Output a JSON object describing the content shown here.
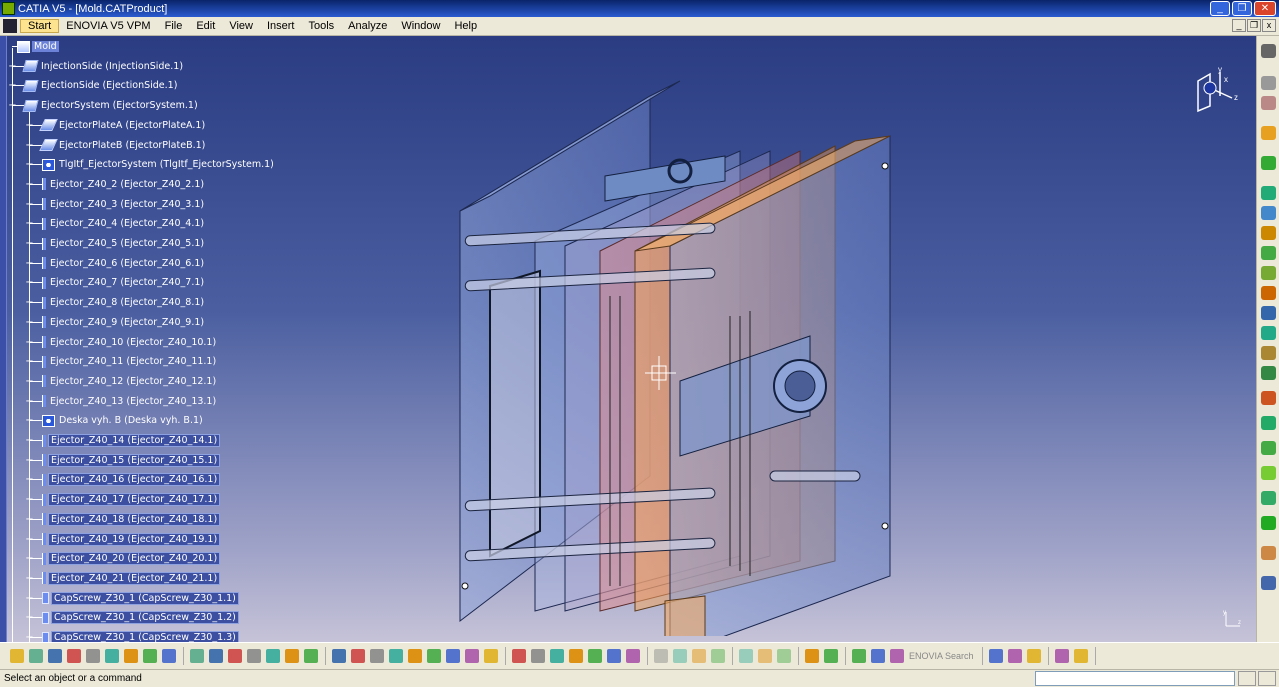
{
  "window": {
    "title": "CATIA V5 - [Mold.CATProduct]",
    "buttons": [
      "_",
      "❐",
      "✕"
    ]
  },
  "menu": {
    "items": [
      "Start",
      "ENOVIA V5 VPM",
      "File",
      "Edit",
      "View",
      "Insert",
      "Tools",
      "Analyze",
      "Window",
      "Help"
    ],
    "doc_buttons": [
      "_",
      "❐",
      "x"
    ]
  },
  "tree": {
    "nodes": [
      {
        "label": "Mold",
        "level": 0,
        "icon": "product-root-icon"
      },
      {
        "label": "InjectionSide (InjectionSide.1)",
        "level": 1,
        "icon": "product-icon"
      },
      {
        "label": "EjectionSide (EjectionSide.1)",
        "level": 1,
        "icon": "product-icon"
      },
      {
        "label": "EjectorSystem (EjectorSystem.1)",
        "level": 1,
        "icon": "product-icon"
      },
      {
        "label": "EjectorPlateA (EjectorPlateA.1)",
        "level": 2,
        "icon": "part-icon"
      },
      {
        "label": "EjectorPlateB (EjectorPlateB.1)",
        "level": 2,
        "icon": "part-icon"
      },
      {
        "label": "TlgItf_EjectorSystem (TlgItf_EjectorSystem.1)",
        "level": 2,
        "icon": "system-icon"
      },
      {
        "label": "Ejector_Z40_2 (Ejector_Z40_2.1)",
        "level": 2,
        "icon": "pin-icon"
      },
      {
        "label": "Ejector_Z40_3 (Ejector_Z40_3.1)",
        "level": 2,
        "icon": "pin-icon"
      },
      {
        "label": "Ejector_Z40_4 (Ejector_Z40_4.1)",
        "level": 2,
        "icon": "pin-icon"
      },
      {
        "label": "Ejector_Z40_5 (Ejector_Z40_5.1)",
        "level": 2,
        "icon": "pin-icon"
      },
      {
        "label": "Ejector_Z40_6 (Ejector_Z40_6.1)",
        "level": 2,
        "icon": "pin-icon"
      },
      {
        "label": "Ejector_Z40_7 (Ejector_Z40_7.1)",
        "level": 2,
        "icon": "pin-icon"
      },
      {
        "label": "Ejector_Z40_8 (Ejector_Z40_8.1)",
        "level": 2,
        "icon": "pin-icon"
      },
      {
        "label": "Ejector_Z40_9 (Ejector_Z40_9.1)",
        "level": 2,
        "icon": "pin-icon"
      },
      {
        "label": "Ejector_Z40_10 (Ejector_Z40_10.1)",
        "level": 2,
        "icon": "pin-icon"
      },
      {
        "label": "Ejector_Z40_11 (Ejector_Z40_11.1)",
        "level": 2,
        "icon": "pin-icon"
      },
      {
        "label": "Ejector_Z40_12 (Ejector_Z40_12.1)",
        "level": 2,
        "icon": "pin-icon"
      },
      {
        "label": "Ejector_Z40_13 (Ejector_Z40_13.1)",
        "level": 2,
        "icon": "pin-icon"
      },
      {
        "label": "Deska vyh. B (Deska vyh. B.1)",
        "level": 2,
        "icon": "system-icon"
      },
      {
        "label": "Ejector_Z40_14 (Ejector_Z40_14.1)",
        "level": 2,
        "icon": "pin-icon"
      },
      {
        "label": "Ejector_Z40_15 (Ejector_Z40_15.1)",
        "level": 2,
        "icon": "pin-icon"
      },
      {
        "label": "Ejector_Z40_16 (Ejector_Z40_16.1)",
        "level": 2,
        "icon": "pin-icon"
      },
      {
        "label": "Ejector_Z40_17 (Ejector_Z40_17.1)",
        "level": 2,
        "icon": "pin-icon"
      },
      {
        "label": "Ejector_Z40_18 (Ejector_Z40_18.1)",
        "level": 2,
        "icon": "pin-icon"
      },
      {
        "label": "Ejector_Z40_19 (Ejector_Z40_19.1)",
        "level": 2,
        "icon": "pin-icon"
      },
      {
        "label": "Ejector_Z40_20 (Ejector_Z40_20.1)",
        "level": 2,
        "icon": "pin-icon"
      },
      {
        "label": "Ejector_Z40_21 (Ejector_Z40_21.1)",
        "level": 2,
        "icon": "pin-icon"
      },
      {
        "label": "CapScrew_Z30_1 (CapScrew_Z30_1.1)",
        "level": 2,
        "icon": "screw-icon"
      },
      {
        "label": "CapScrew_Z30_1 (CapScrew_Z30_1.2)",
        "level": 2,
        "icon": "screw-icon"
      },
      {
        "label": "CapScrew_Z30_1 (CapScrew_Z30_1.3)",
        "level": 2,
        "icon": "screw-icon"
      }
    ]
  },
  "compass": {
    "axes": [
      "x",
      "y",
      "z"
    ]
  },
  "bottom_toolbar": {
    "enovia_search_label": "ENOVIA Search"
  },
  "status": {
    "message": "Select an object or a command"
  },
  "colors": {
    "background_top": "#2b3c82",
    "background_bottom": "#c6c3d8",
    "selection": "#3d4fa0",
    "toolbar": "#ece9d8"
  }
}
